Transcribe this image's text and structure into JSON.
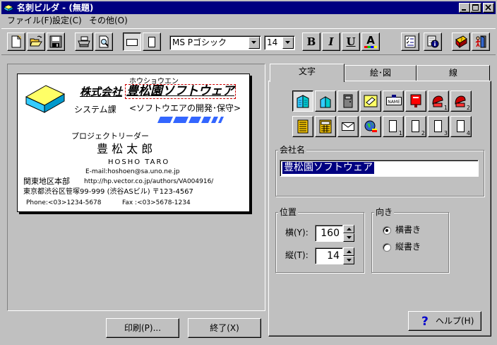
{
  "window": {
    "title": "名刺ビルダ - (無題)"
  },
  "menu": [
    {
      "label": "ファイル(F)"
    },
    {
      "label": "設定(C)"
    },
    {
      "label": "その他(O)"
    }
  ],
  "toolbar": {
    "font_name": "MS Pゴシック",
    "font_size": "14",
    "bold_label": "B",
    "italic_label": "I",
    "underline_label": "U",
    "color_label": "A"
  },
  "card": {
    "furigana": "ホウショウエン",
    "company_prefix": "株式会社",
    "company_name": "豊松園ソフトウェア",
    "department": "システム課",
    "tagline": "<ソフトウエアの開発･保守>",
    "title": "プロジェクトリーダー",
    "name": "豊 松 太 郎",
    "name_roman": "HOSHO TARO",
    "email": "E-mail:hoshoen@sa.uno.ne.jp",
    "branch": "関東地区本部",
    "url": "http://hp.vector.co.jp/authors/VA004916/",
    "address": "東京都渋谷区笹塚99-999 (渋谷ASビル) 〒123-4567",
    "phone": "Phone:<03>1234-5678",
    "fax": "Fax :<03>5678-1234"
  },
  "buttons": {
    "print": "印刷(P)...",
    "exit": "終了(X)",
    "help": "ヘルプ(H)"
  },
  "tabs": [
    {
      "label": "文字"
    },
    {
      "label": "絵･図"
    },
    {
      "label": "線"
    }
  ],
  "panel": {
    "company_group_label": "会社名",
    "company_value": "豊松園ソフトウェア",
    "position_group_label": "位置",
    "horizontal_label": "横(Y):",
    "horizontal_value": "160",
    "vertical_label": "縦(T):",
    "vertical_value": "14",
    "direction_group_label": "向き",
    "horizontal_writing": "横書き",
    "vertical_writing": "縦書き",
    "subscripts": [
      "1",
      "2",
      "1",
      "2",
      "3",
      "4"
    ],
    "name_icon_text": "NAME"
  },
  "colors": {
    "title_bar": "#000080",
    "face": "#c0c0c0",
    "selection": "#000080",
    "logo_yellow": "#ffff66",
    "logo_cyan": "#33ccff",
    "accent_blue": "#3366ff"
  }
}
